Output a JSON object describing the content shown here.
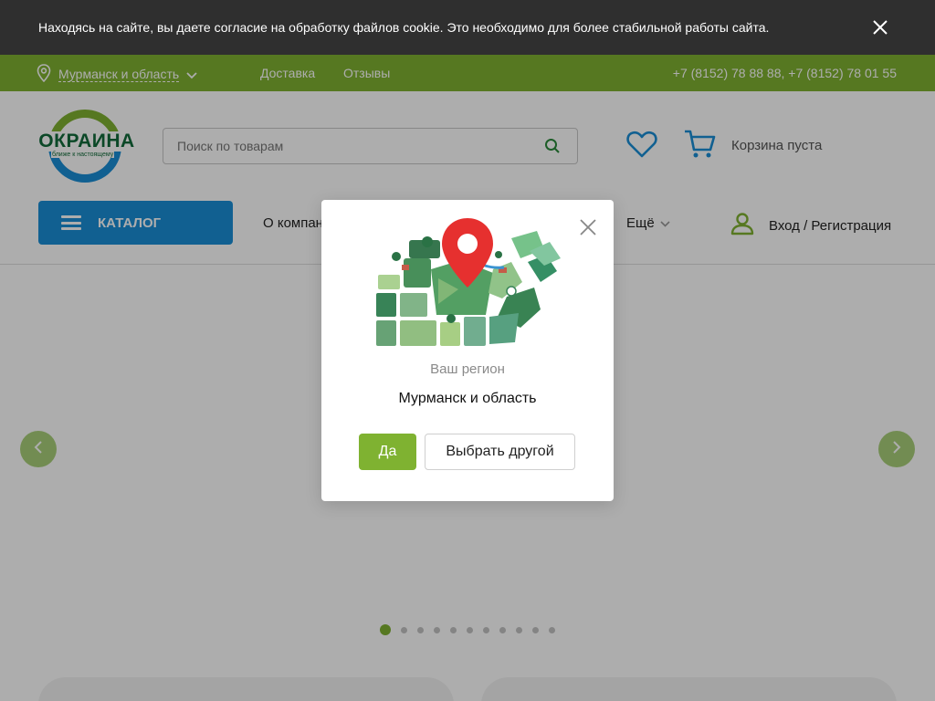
{
  "cookie": {
    "text": "Находясь на сайте, вы даете согласие на обработку файлов cookie. Это необходимо для более стабильной работы сайта."
  },
  "topbar": {
    "region": "Мурманск и область",
    "links": [
      "Доставка",
      "Отзывы"
    ],
    "phones": "+7 (8152) 78 88 88, +7 (8152) 78 01 55"
  },
  "header": {
    "logo_text": "ОКРАИНА",
    "logo_tagline": "ближе к настоящему",
    "search_placeholder": "Поиск по товарам",
    "cart_text": "Корзина пуста",
    "catalog_label": "КАТАЛОГ",
    "nav_about": "О компании",
    "nav_more": "Ещё",
    "login": "Вход / Регистрация"
  },
  "carousel": {
    "total_slides": 11,
    "active_slide": 1
  },
  "modal": {
    "subtitle": "Ваш регион",
    "region": "Мурманск и область",
    "yes_label": "Да",
    "other_label": "Выбрать другой"
  },
  "colors": {
    "green": "#7fb231",
    "blue": "#1a8ed6",
    "dark_bar": "#2f2f2f",
    "pin_red": "#e6302f"
  }
}
